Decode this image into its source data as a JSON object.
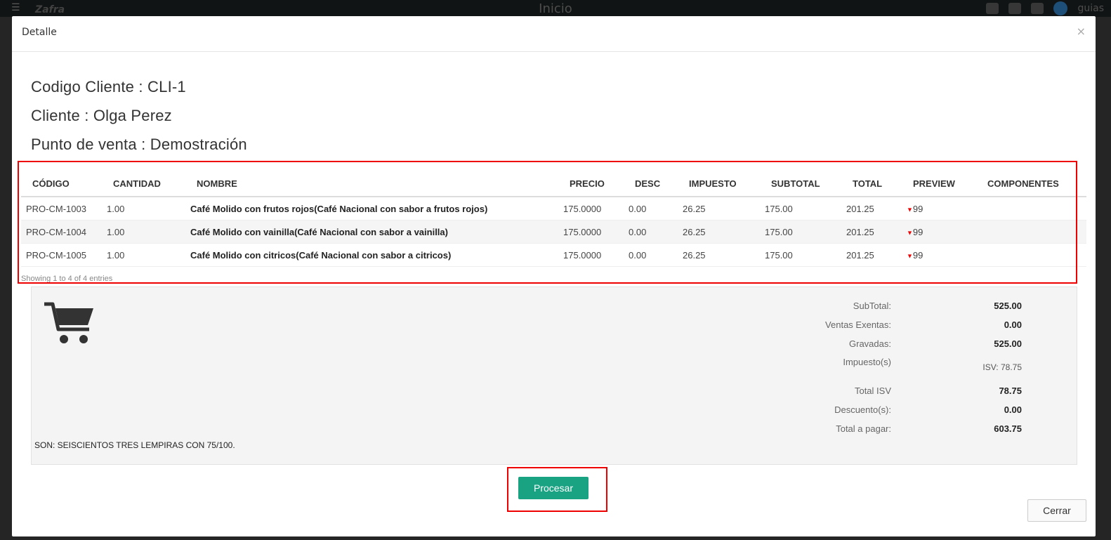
{
  "navbar": {
    "menu_icon": "menu-icon",
    "logo_text": "Zafra",
    "title": "Inicio",
    "user_name": "guias"
  },
  "modal": {
    "title": "Detalle",
    "close_symbol": "×",
    "info": {
      "codigo_cliente": "Codigo Cliente : CLI-1",
      "cliente": "Cliente : Olga Perez",
      "punto_venta": "Punto de venta : Demostración"
    },
    "table": {
      "headers": [
        "CÓDIGO",
        "CANTIDAD",
        "NOMBRE",
        "PRECIO",
        "DESC",
        "IMPUESTO",
        "SUBTOTAL",
        "TOTAL",
        "PREVIEW",
        "COMPONENTES"
      ],
      "rows": [
        {
          "codigo": "PRO-CM-1003",
          "cantidad": "1.00",
          "nombre": "Café Molido con frutos rojos(Café Nacional con sabor a frutos rojos)",
          "precio": "175.0000",
          "desc": "0.00",
          "impuesto": "26.25",
          "subtotal": "175.00",
          "total": "201.25",
          "preview": "99",
          "componentes": ""
        },
        {
          "codigo": "PRO-CM-1004",
          "cantidad": "1.00",
          "nombre": "Café Molido con vainilla(Café Nacional con sabor a vainilla)",
          "precio": "175.0000",
          "desc": "0.00",
          "impuesto": "26.25",
          "subtotal": "175.00",
          "total": "201.25",
          "preview": "99",
          "componentes": ""
        },
        {
          "codigo": "PRO-CM-1005",
          "cantidad": "1.00",
          "nombre": "Café Molido con citricos(Café Nacional con sabor a citricos)",
          "precio": "175.0000",
          "desc": "0.00",
          "impuesto": "26.25",
          "subtotal": "175.00",
          "total": "201.25",
          "preview": "99",
          "componentes": ""
        }
      ],
      "showing": "Showing 1 to 4 of 4 entries"
    },
    "summary": {
      "subtotal_label": "SubTotal:",
      "subtotal_value": "525.00",
      "exentas_label": "Ventas Exentas:",
      "exentas_value": "0.00",
      "gravadas_label": "Gravadas:",
      "gravadas_value": "525.00",
      "impuestos_label": "Impuesto(s)",
      "impuestos_value": "ISV: 78.75",
      "total_isv_label": "Total ISV",
      "total_isv_value": "78.75",
      "descuentos_label": "Descuento(s):",
      "descuentos_value": "0.00",
      "total_pagar_label": "Total a pagar:",
      "total_pagar_value": "603.75",
      "son_text": "SON: SEISCIENTOS TRES LEMPIRAS CON 75/100."
    },
    "buttons": {
      "procesar": "Procesar",
      "cerrar": "Cerrar"
    },
    "colors": {
      "accent": "#1aa383",
      "highlight": "#e00000"
    }
  }
}
